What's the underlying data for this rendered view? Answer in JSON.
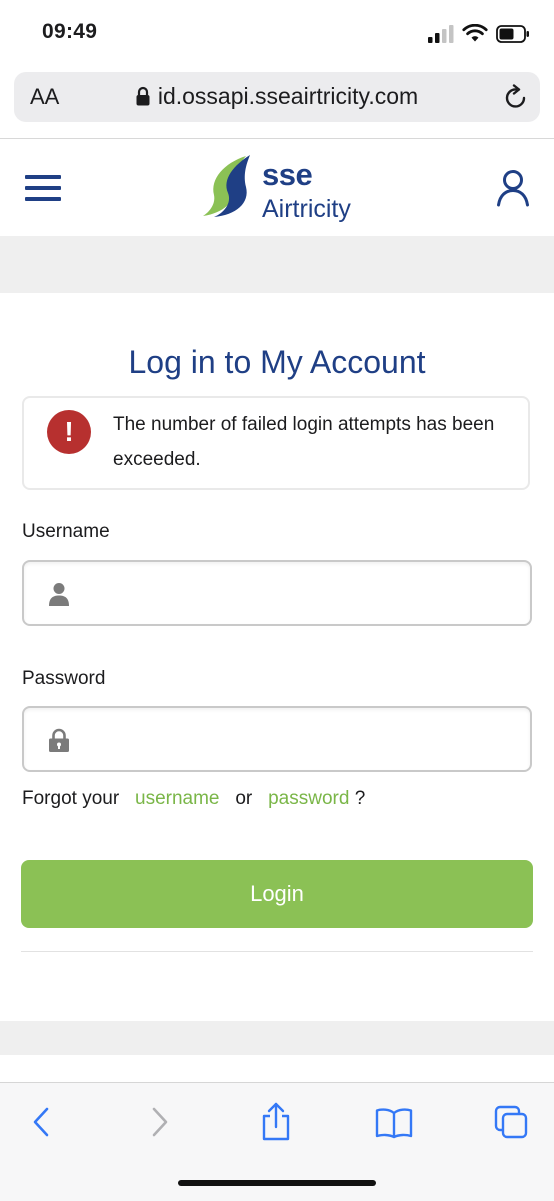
{
  "status_bar": {
    "time": "09:49"
  },
  "browser": {
    "aa_label": "AA",
    "url": "id.ossapi.sseairtricity.com"
  },
  "brand": {
    "line1": "sse",
    "line2": "Airtricity",
    "navy": "#1f3f85",
    "green": "#8bc155"
  },
  "login": {
    "title": "Log in to My Account",
    "error_message": "The number of failed login attempts has been exceeded.",
    "username_label": "Username",
    "username_value": "",
    "password_label": "Password",
    "password_value": "",
    "forgot_prefix": "Forgot your",
    "forgot_username": "username",
    "forgot_or": "or",
    "forgot_password": "password",
    "forgot_suffix": "?",
    "login_button": "Login"
  },
  "icons": {
    "menu": "hamburger-icon",
    "account": "user-icon",
    "error": "alert-icon",
    "username_field": "person-icon",
    "password_field": "lock-icon",
    "back": "chevron-left-icon",
    "forward": "chevron-right-icon",
    "share": "share-icon",
    "bookmarks": "book-icon",
    "tabs": "tabs-icon"
  }
}
